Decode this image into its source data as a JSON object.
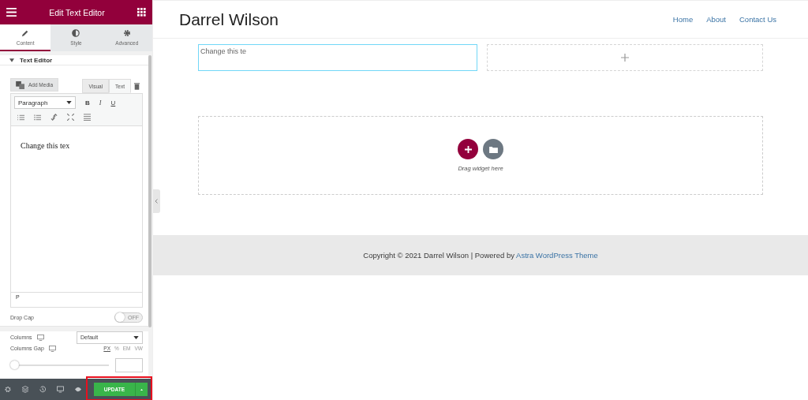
{
  "panel": {
    "title": "Edit Text Editor",
    "tabs": [
      {
        "label": "Content",
        "selected": true
      },
      {
        "label": "Style",
        "selected": false
      },
      {
        "label": "Advanced",
        "selected": false
      }
    ],
    "section_title": "Text Editor",
    "editor": {
      "add_media": "Add Media",
      "modes": [
        {
          "label": "Visual",
          "selected": false
        },
        {
          "label": "Text",
          "selected": true
        }
      ],
      "format": "Paragraph",
      "styles": [
        "B",
        "I",
        "U"
      ],
      "content": "Change this tex",
      "path": "P"
    },
    "drop_cap": {
      "label": "Drop Cap",
      "on": false,
      "state_text": "OFF"
    },
    "columns": {
      "label": "Columns",
      "value": "Default"
    },
    "columns_gap": {
      "label": "Columns Gap",
      "units": [
        {
          "label": "PX",
          "selected": true
        },
        {
          "label": "%",
          "selected": false
        },
        {
          "label": "EM",
          "selected": false
        },
        {
          "label": "VW",
          "selected": false
        }
      ],
      "level": 0
    },
    "update": "UPDATE"
  },
  "site": {
    "title": "Darrel Wilson",
    "nav": [
      "Home",
      "About",
      "Contact Us"
    ],
    "columns": [
      {
        "kind": "text",
        "text": "Change this te"
      },
      {
        "kind": "empty"
      }
    ],
    "drop_hint": "Drag widget here",
    "footer": {
      "text": "Copyright © 2021 Darrel Wilson | Powered by ",
      "link": "Astra WordPress Theme"
    }
  }
}
